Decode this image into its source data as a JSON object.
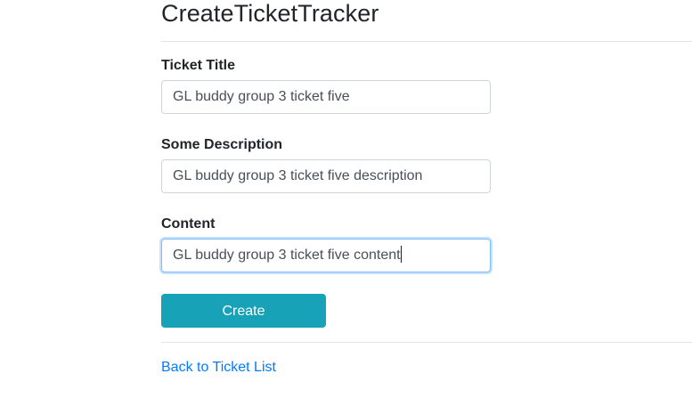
{
  "page": {
    "title": "CreateTicketTracker"
  },
  "form": {
    "fields": [
      {
        "label": "Ticket Title",
        "value": "GL buddy group 3 ticket five"
      },
      {
        "label": "Some Description",
        "value": "GL buddy group 3 ticket five description"
      },
      {
        "label": "Content",
        "value": "GL buddy group 3 ticket five content",
        "focused": true
      }
    ],
    "submit_label": "Create"
  },
  "footer": {
    "back_link_label": "Back to Ticket List"
  },
  "colors": {
    "button_bg": "#17a2b8",
    "link": "#007bff",
    "focus_border": "#80bdff"
  }
}
